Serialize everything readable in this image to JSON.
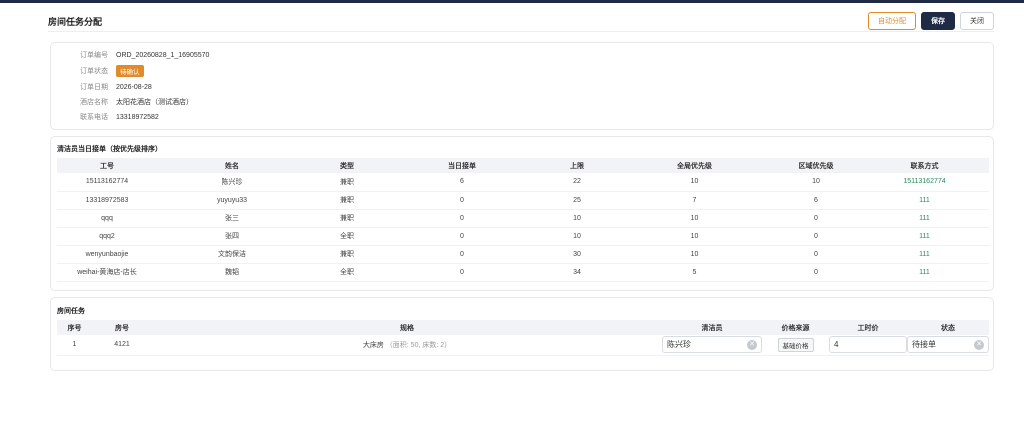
{
  "header": {
    "title": "房间任务分配",
    "auto_assign_label": "自动分配",
    "save_label": "保存",
    "close_label": "关闭"
  },
  "order_info": {
    "order_no_label": "订单编号",
    "order_no": "ORD_20260828_1_16905570",
    "status_label": "订单状态",
    "status": "待确认",
    "date_label": "订单日期",
    "date": "2026-08-28",
    "hotel_label": "酒店名称",
    "hotel": "太阳花酒店（测试酒店）",
    "phone_label": "联系电话",
    "phone": "13318972582"
  },
  "cleaners": {
    "title": "清洁员当日接单（按优先级排序）",
    "columns": [
      "工号",
      "姓名",
      "类型",
      "当日接单",
      "上限",
      "全局优先级",
      "区域优先级",
      "联系方式"
    ],
    "rows": [
      [
        "15113162774",
        "陈兴珍",
        "兼职",
        "6",
        "22",
        "10",
        "10",
        "15113162774"
      ],
      [
        "13318972583",
        "yuyuyu33",
        "兼职",
        "0",
        "25",
        "7",
        "6",
        "111"
      ],
      [
        "qqq",
        "张三",
        "兼职",
        "0",
        "10",
        "10",
        "0",
        "111"
      ],
      [
        "qqq2",
        "张四",
        "全职",
        "0",
        "10",
        "10",
        "0",
        "111"
      ],
      [
        "wenyunbaojie",
        "文韵保洁",
        "兼职",
        "0",
        "30",
        "10",
        "0",
        "111"
      ],
      [
        "weihai-黄海店-店长",
        "魏韬",
        "全职",
        "0",
        "34",
        "5",
        "0",
        "111"
      ]
    ]
  },
  "rooms": {
    "title": "房间任务",
    "columns": [
      "序号",
      "房号",
      "规格",
      "清洁员",
      "价格来源",
      "工时价",
      "状态"
    ],
    "rows": [
      {
        "index": "1",
        "room_no": "4121",
        "spec": "大床房",
        "spec_detail": "（面积: 50, 床数: 2）",
        "cleaner": "陈兴珍",
        "price_source": "基础价格",
        "hourly_price": "4",
        "status": "待接单"
      }
    ]
  }
}
